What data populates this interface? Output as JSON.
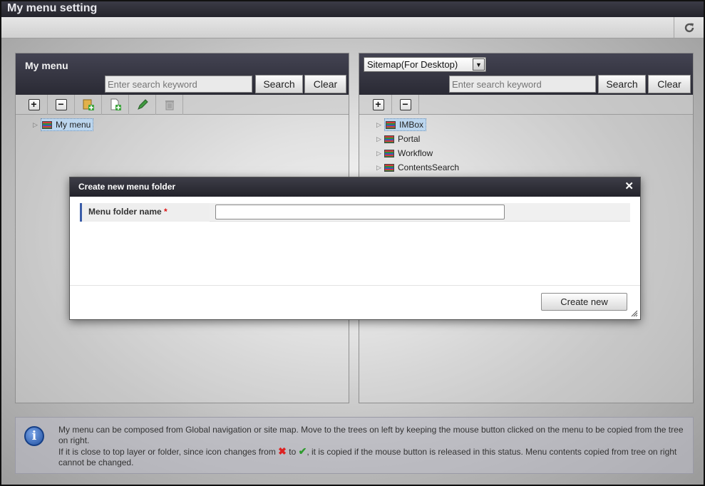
{
  "window": {
    "title": "My menu setting"
  },
  "toolbar": {
    "refresh_icon": "refresh-icon"
  },
  "left_panel": {
    "title": "My menu",
    "search_placeholder": "Enter search keyword",
    "search_label": "Search",
    "clear_label": "Clear",
    "tools": [
      "expand-all-icon",
      "collapse-all-icon",
      "new-folder-icon",
      "new-item-icon",
      "edit-icon",
      "delete-icon"
    ],
    "tree": [
      {
        "label": "My menu",
        "selected": true
      }
    ]
  },
  "right_panel": {
    "source_select": "Sitemap(For Desktop)",
    "search_placeholder": "Enter search keyword",
    "search_label": "Search",
    "clear_label": "Clear",
    "tree": [
      {
        "label": "IMBox",
        "selected": true
      },
      {
        "label": "Portal",
        "selected": false
      },
      {
        "label": "Workflow",
        "selected": false
      },
      {
        "label": "ContentsSearch",
        "selected": false
      }
    ]
  },
  "modal": {
    "title": "Create new menu folder",
    "field_label": "Menu folder name",
    "required_mark": "*",
    "field_value": "",
    "create_label": "Create new"
  },
  "info": {
    "line1": "My menu can be composed from Global navigation or site map. Move to the trees on left by keeping the mouse button clicked on the menu to be copied from the tree on right.",
    "line2_a": "If it is close to top layer or folder, since icon changes from",
    "line2_b": "to",
    "line2_c": ", it is copied if the mouse button is released in this status. Menu contents copied from tree on right cannot be changed."
  },
  "colors": {
    "header": "#2a2a34",
    "accent": "#3a5ca8",
    "required": "#dd1111",
    "selection": "#bcd6ee"
  }
}
